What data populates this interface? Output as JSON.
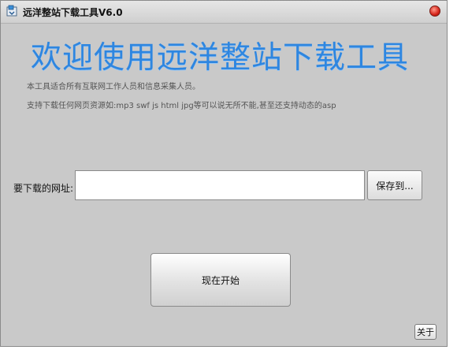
{
  "window": {
    "title": "远洋整站下载工具V6.0"
  },
  "main": {
    "headline": "欢迎使用远洋整站下载工具",
    "description_line1": "本工具适合所有互联网工作人员和信息采集人员。",
    "description_line2": "支持下载任何网页资源如:mp3 swf js html jpg等可以说无所不能,甚至还支持动态的asp"
  },
  "form": {
    "url_label": "要下载的网址:",
    "url_value": "",
    "save_button_label": "保存到..."
  },
  "actions": {
    "start_button_label": "现在开始",
    "about_button_label": "关于"
  },
  "icons": {
    "app_icon": "app-icon",
    "close_icon": "close-icon"
  },
  "colors": {
    "headline": "#2e86e0",
    "window_background": "#c9c9c9",
    "close_button": "#d6241a"
  }
}
